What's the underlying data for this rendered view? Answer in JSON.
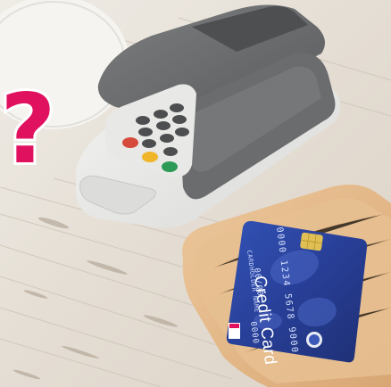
{
  "image": {
    "subject": "card-payment-terminal-with-credit-card",
    "overlay_symbol": "?",
    "card": {
      "brand_text": "Credit Card",
      "number_text": "0000 1234 5678 9000",
      "expiry_text": "00/00",
      "code_text": "0000",
      "small_text": "CARDHOLDER NAME"
    },
    "colors": {
      "question_mark": "#e0115f",
      "card_blue": "#2a3f9a",
      "tray_wood": "#e2b888",
      "terminal_gray": "#6e6f71",
      "terminal_white": "#e9e9e7",
      "table_wood": "#e6dfd6"
    },
    "keypad_keys": [
      {
        "icon": "cancel-key",
        "color": "#d64a3c"
      },
      {
        "icon": "clear-key",
        "color": "#f0b62a"
      },
      {
        "icon": "enter-key",
        "color": "#2b9a55"
      }
    ]
  }
}
